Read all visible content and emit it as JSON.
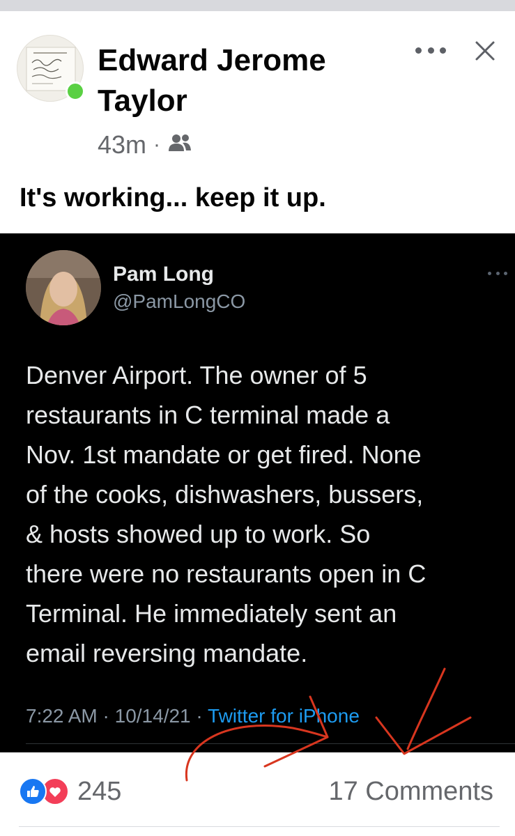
{
  "post": {
    "author": "Edward Jerome Taylor",
    "time": "43m",
    "separator": "·",
    "audience_icon": "friends-icon",
    "text": "It's working... keep it up."
  },
  "tweet": {
    "name": "Pam Long",
    "handle": "@PamLongCO",
    "text": "Denver Airport. The owner of 5\nrestaurants in C terminal made a\nNov. 1st mandate or get fired. None\nof the cooks, dishwashers, bussers,\n& hosts showed up to work.  So\nthere were no restaurants open in C\nTerminal.  He immediately sent an\nemail reversing mandate.",
    "time": "7:22 AM",
    "date": "10/14/21",
    "separator": "·",
    "source": "Twitter for iPhone"
  },
  "stats": {
    "reaction_count": "245",
    "comments": "17 Comments",
    "reaction_icons": [
      "like-icon",
      "love-icon"
    ]
  },
  "colors": {
    "online": "#5ad043",
    "like": "#1877f2",
    "love": "#f33e58",
    "twitter_link": "#1d9bf0",
    "annotation": "#d8361f"
  }
}
